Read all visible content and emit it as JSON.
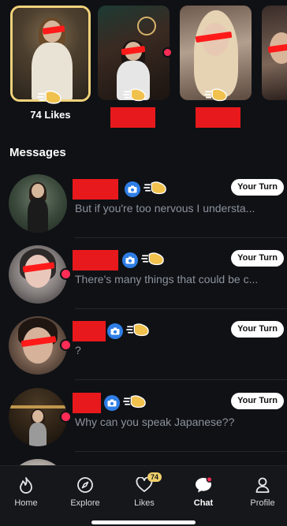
{
  "matches": {
    "likes_label": "74 Likes"
  },
  "messages": {
    "title": "Messages",
    "turn_label": "Your Turn",
    "items": [
      {
        "preview": "But if you're too nervous I understa...",
        "online": false,
        "has_turn": true
      },
      {
        "preview": "There's many things that could be c...",
        "online": true,
        "has_turn": true
      },
      {
        "preview": "?",
        "online": true,
        "has_turn": true
      },
      {
        "preview": "Why can you speak Japanese??",
        "online": true,
        "has_turn": true
      }
    ]
  },
  "nav": {
    "home": "Home",
    "explore": "Explore",
    "likes": "Likes",
    "likes_badge": "74",
    "chat": "Chat",
    "profile": "Profile"
  },
  "colors": {
    "background": "#0f1115",
    "accent_gold": "#f1d27a",
    "online": "#ff2d55",
    "camera_badge": "#2f7ee6",
    "redaction": "#e8191c"
  },
  "icons": [
    "hand-wave-icon",
    "camera-icon",
    "flame-icon",
    "compass-icon",
    "heart-icon",
    "chat-bubble-icon",
    "person-icon"
  ]
}
